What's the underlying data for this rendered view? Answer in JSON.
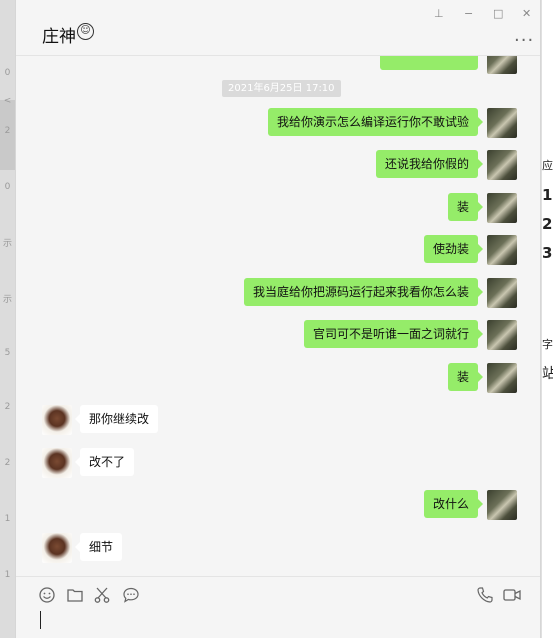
{
  "window": {
    "title": "庄神",
    "title_emoji": "☺",
    "controls": {
      "pin": "⊥",
      "minimize": "−",
      "maximize": "□",
      "close": "✕"
    },
    "more": "···"
  },
  "left_gutter": [
    "0",
    "<",
    "2",
    "0",
    "示",
    "示",
    "5",
    "2",
    "2",
    "1",
    "1"
  ],
  "right_gutter": [
    "应用",
    "1",
    "2",
    "3",
    "字",
    "站"
  ],
  "chat": {
    "timestamp": "2021年6月25日 17:10",
    "messages": [
      {
        "from": "me",
        "text": "我给你演示怎么编译运行你不敢试验"
      },
      {
        "from": "me",
        "text": "还说我给你假的"
      },
      {
        "from": "me",
        "text": "装"
      },
      {
        "from": "me",
        "text": "使劲装"
      },
      {
        "from": "me",
        "text": "我当庭给你把源码运行起来我看你怎么装"
      },
      {
        "from": "me",
        "text": "官司可不是听谁一面之词就行"
      },
      {
        "from": "me",
        "text": "装"
      },
      {
        "from": "other",
        "text": "那你继续改"
      },
      {
        "from": "other",
        "text": "改不了"
      },
      {
        "from": "me",
        "text": "改什么"
      },
      {
        "from": "other",
        "text": "细节"
      }
    ]
  },
  "toolbar": {
    "left": [
      "emoji-icon",
      "folder-icon",
      "scissors-icon",
      "chat-bubble-icon"
    ],
    "right": [
      "phone-icon",
      "video-icon"
    ]
  },
  "input": {
    "value": ""
  },
  "colors": {
    "my_bubble": "#95ec69",
    "other_bubble": "#ffffff",
    "window_bg": "#f5f5f5"
  }
}
